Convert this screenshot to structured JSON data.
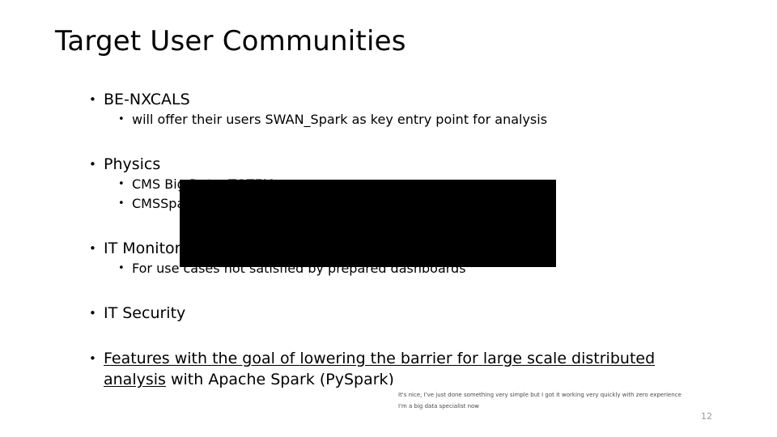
{
  "slide": {
    "title": "Target User Communities",
    "page_number": "12",
    "background_color": "#ffffff",
    "text_color": "#000000",
    "page_number_color": "#9b9b9b"
  },
  "bullets": [
    {
      "level": 1,
      "text": "BE-NXCALS"
    },
    {
      "level": 2,
      "text": "will offer their users SWAN_Spark as key entry point for analysis"
    },
    {
      "level": 1,
      "text": "Physics"
    },
    {
      "level": 2,
      "text": "CMS Big Data, TOTEM"
    },
    {
      "level": 2,
      "text": "CMSSpark"
    },
    {
      "level": 1,
      "text": "IT Monitoring"
    },
    {
      "level": 2,
      "text": "For use cases not satisfied by prepared dashboards"
    },
    {
      "level": 1,
      "text": "IT Security"
    }
  ],
  "features_bullet": {
    "lead": "Features with the goal of ",
    "emphasis": "lowering the barrier for large scale distributed analysis",
    "trail": " with Apache Spark (PySpark)"
  },
  "overlay": {
    "redaction_color": "#000000",
    "card_background": "#ffffff",
    "card_text_color": "#4a4a4a",
    "line_1": "It's nice, I've just done something very simple but I got it working very quickly with zero experience",
    "line_2": "I'm a big data specialist now"
  }
}
